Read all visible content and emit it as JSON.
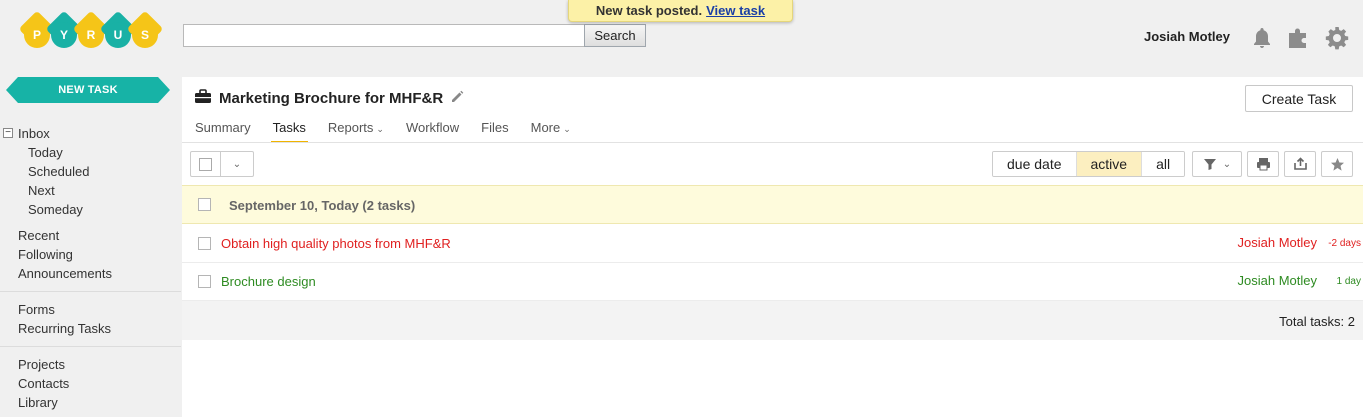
{
  "app": {
    "logo_letters": [
      "P",
      "Y",
      "R",
      "U",
      "S"
    ],
    "search": {
      "value": "",
      "button_label": "Search"
    },
    "toast": {
      "text": "New task posted.",
      "link": "View task"
    },
    "user_name": "Josiah Motley"
  },
  "sidebar": {
    "new_task_label": "NEW TASK",
    "inbox_label": "Inbox",
    "inbox_children": [
      "Today",
      "Scheduled",
      "Next",
      "Someday"
    ],
    "group1": [
      "Recent",
      "Following",
      "Announcements"
    ],
    "group2": [
      "Forms",
      "Recurring Tasks"
    ],
    "group3": [
      "Projects",
      "Contacts",
      "Library"
    ]
  },
  "project": {
    "title": "Marketing Brochure for MHF&R",
    "create_task_label": "Create Task",
    "tabs": [
      "Summary",
      "Tasks",
      "Reports",
      "Workflow",
      "Files",
      "More"
    ],
    "active_tab": "Tasks"
  },
  "toolbar": {
    "filters": [
      "due date",
      "active",
      "all"
    ],
    "active_filter": "active"
  },
  "task_list": {
    "group_label": "September 10, Today (2 tasks)",
    "tasks": [
      {
        "name": "Obtain high quality photos from MHF&R",
        "assignee": "Josiah Motley",
        "due": "-2 days",
        "color": "#e02020"
      },
      {
        "name": "Brochure design",
        "assignee": "Josiah Motley",
        "due": "1 day",
        "color": "#2e8b22"
      }
    ],
    "total_label": "Total tasks: 2"
  },
  "colors": {
    "brand_teal": "#17b3a6",
    "logo_yellow": "#f5c518",
    "logo_teal": "#19b1a5",
    "accent_tab": "#f0b400",
    "overdue": "#e02020",
    "upcoming": "#2e8b22"
  }
}
